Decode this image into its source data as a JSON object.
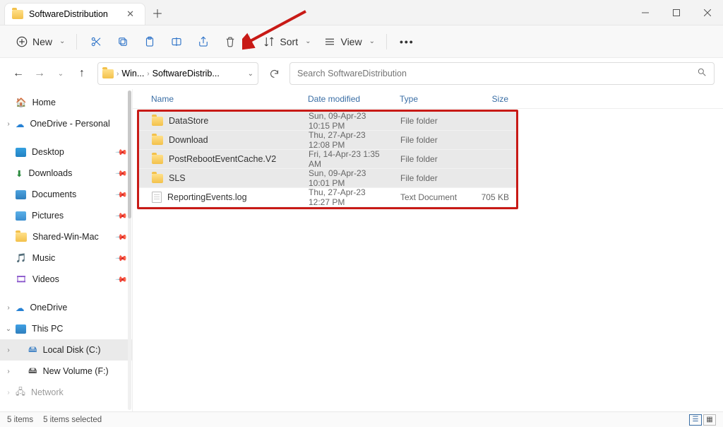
{
  "window": {
    "tab_title": "SoftwareDistribution"
  },
  "toolbar": {
    "new_label": "New",
    "sort_label": "Sort",
    "view_label": "View"
  },
  "breadcrumb": {
    "seg1": "Win...",
    "seg2": "SoftwareDistrib..."
  },
  "search": {
    "placeholder": "Search SoftwareDistribution"
  },
  "sidebar": {
    "home": "Home",
    "onedrive_personal": "OneDrive - Personal",
    "quick": [
      {
        "label": "Desktop"
      },
      {
        "label": "Downloads"
      },
      {
        "label": "Documents"
      },
      {
        "label": "Pictures"
      },
      {
        "label": "Shared-Win-Mac"
      },
      {
        "label": "Music"
      },
      {
        "label": "Videos"
      }
    ],
    "onedrive": "OneDrive",
    "this_pc": "This PC",
    "drives": [
      {
        "label": "Local Disk (C:)"
      },
      {
        "label": "New Volume (F:)"
      }
    ],
    "network": "Network"
  },
  "columns": {
    "name": "Name",
    "date": "Date modified",
    "type": "Type",
    "size": "Size"
  },
  "files": [
    {
      "name": "DataStore",
      "date": "Sun, 09-Apr-23 10:15 PM",
      "type": "File folder",
      "size": "",
      "icon": "folder"
    },
    {
      "name": "Download",
      "date": "Thu, 27-Apr-23 12:08 PM",
      "type": "File folder",
      "size": "",
      "icon": "folder"
    },
    {
      "name": "PostRebootEventCache.V2",
      "date": "Fri, 14-Apr-23 1:35 AM",
      "type": "File folder",
      "size": "",
      "icon": "folder"
    },
    {
      "name": "SLS",
      "date": "Sun, 09-Apr-23 10:01 PM",
      "type": "File folder",
      "size": "",
      "icon": "folder"
    },
    {
      "name": "ReportingEvents.log",
      "date": "Thu, 27-Apr-23 12:27 PM",
      "type": "Text Document",
      "size": "705 KB",
      "icon": "file"
    }
  ],
  "status": {
    "count": "5 items",
    "selected": "5 items selected"
  }
}
